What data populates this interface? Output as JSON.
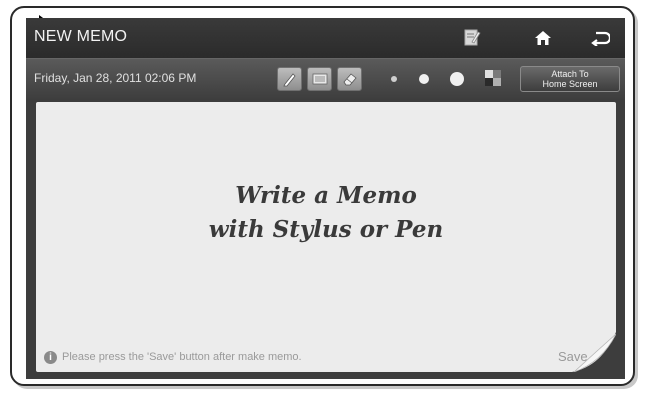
{
  "window": {
    "title": "NEW MEMO"
  },
  "titlebar": {
    "icons": [
      "memo-list-icon",
      "home-icon",
      "back-icon"
    ]
  },
  "toolbar": {
    "datetime": "Friday, Jan 28, 2011 02:06 PM",
    "tools": [
      "pen-icon",
      "keyboard-icon",
      "eraser-icon"
    ],
    "brush_sizes": [
      "small",
      "medium",
      "large"
    ],
    "palette_icon": "color-palette-icon",
    "attach_line1": "Attach To",
    "attach_line2": "Home Screen"
  },
  "memo": {
    "line1": "Write a Memo",
    "line2": "with Stylus or Pen",
    "info": "Please press the 'Save' button after make memo.",
    "save_label": "Save"
  },
  "colors": {
    "titlebar_bg": "#2b2b2b",
    "toolbar_bg": "#4a4a4a",
    "paper": "#ececec",
    "text_light": "#f2f2f2"
  }
}
